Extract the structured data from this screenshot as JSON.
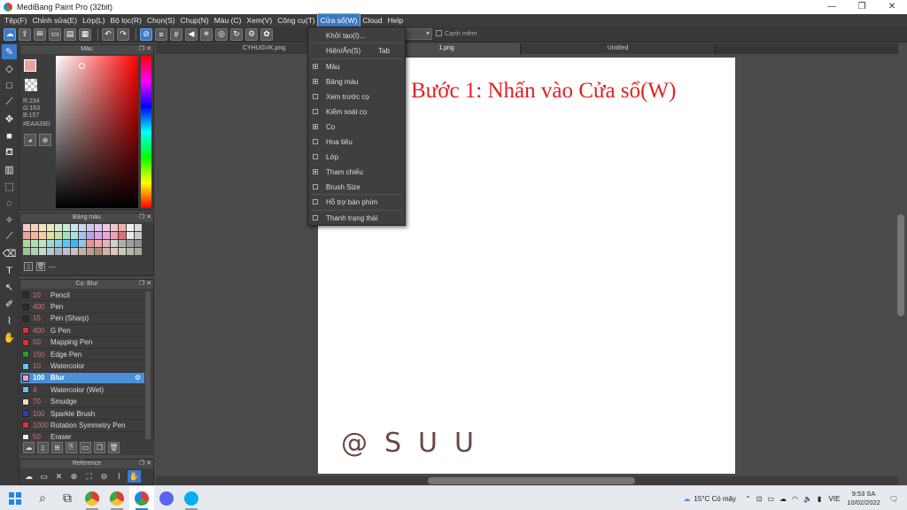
{
  "window": {
    "title": "MediBang Paint Pro (32bit)",
    "min": "—",
    "max": "❐",
    "close": "✕"
  },
  "menu": [
    {
      "label": "Tệp(F)",
      "active": false
    },
    {
      "label": "Chỉnh sửa(E)",
      "active": false
    },
    {
      "label": "Lớp(L)",
      "active": false
    },
    {
      "label": "Bộ lọc(R)",
      "active": false
    },
    {
      "label": "Chọn(S)",
      "active": false
    },
    {
      "label": "Chụp(N)",
      "active": false
    },
    {
      "label": "Màu (C)",
      "active": false
    },
    {
      "label": "Xem(V)",
      "active": false
    },
    {
      "label": "Công cụ(T)",
      "active": false
    },
    {
      "label": "Cửa sổ(W)",
      "active": true
    },
    {
      "label": "Cloud",
      "active": false
    },
    {
      "label": "Help",
      "active": false
    }
  ],
  "toolbar": {
    "antialias_label": "Cạnh mềm"
  },
  "color_panel": {
    "title": "Màu",
    "r": "R:234",
    "g": "G:163",
    "b": "B:157",
    "hex": "#EAA39D",
    "fg_color": "#EAA39D"
  },
  "palette_panel": {
    "title": "Bảng màu",
    "footer": "---",
    "swatches": [
      "#f4c7c3",
      "#f4d2c3",
      "#f4e0c3",
      "#e8e8c8",
      "#d9e8c8",
      "#c8e8d0",
      "#c8e8e8",
      "#c8d8ec",
      "#d0c8ec",
      "#e0c8ec",
      "#ecc8e0",
      "#f4c3d0",
      "#f0b0b0",
      "#f0f0f0",
      "#d8d8d8",
      "#f0a0a0",
      "#f4b4a0",
      "#f4d0a0",
      "#e0e0a8",
      "#c8e0a8",
      "#a8e0b8",
      "#a8e0e0",
      "#a8c4e8",
      "#b8a8e8",
      "#d4a8e8",
      "#e8a8d4",
      "#f0a0b8",
      "#e07070",
      "#e8e8e8",
      "#c8c8c8",
      "#a8d8a0",
      "#b0e0b0",
      "#c0e8c0",
      "#a0d8d0",
      "#80d0e8",
      "#60c8f0",
      "#40b8f0",
      "#90c8e8",
      "#f09090",
      "#f0a8a8",
      "#e8b0c0",
      "#d0d0d0",
      "#b0b0b0",
      "#a0a0a0",
      "#909090",
      "#a0c0a0",
      "#b8d0b8",
      "#c8d8c8",
      "#b8c8d8",
      "#a8b8c8",
      "#c0c0d0",
      "#d0c0c0",
      "#c8b0a0",
      "#b8a090",
      "#a89080",
      "#d0b8a8",
      "#e0c8b8",
      "#c8c8b8",
      "#b8b8a8",
      "#a8a898"
    ]
  },
  "brush_panel": {
    "title": "Cọ: Blur",
    "brushes": [
      {
        "color": "#2b2b2b",
        "size": "10",
        "name": "Pencil"
      },
      {
        "color": "#2b2b2b",
        "size": "400",
        "name": "Pen"
      },
      {
        "color": "#2b2b2b",
        "size": "15",
        "name": "Pen (Sharp)"
      },
      {
        "color": "#e53030",
        "size": "400",
        "name": "G Pen"
      },
      {
        "color": "#e53030",
        "size": "50",
        "name": "Mapping Pen"
      },
      {
        "color": "#20a030",
        "size": "150",
        "name": "Edge Pen"
      },
      {
        "color": "#60c8e8",
        "size": "10",
        "name": "Watercolor"
      },
      {
        "color": "#f4a0c0",
        "size": "100",
        "name": "Blur",
        "selected": true
      },
      {
        "color": "#60c8e8",
        "size": "4",
        "name": "Watercolor (Wet)"
      },
      {
        "color": "#f4d8c0",
        "size": "70",
        "name": "Smudge"
      },
      {
        "color": "#3040c0",
        "size": "100",
        "name": "Sparkle Brush"
      },
      {
        "color": "#e53030",
        "size": "1000",
        "name": "Rotation Symmetry Pen"
      },
      {
        "color": "#f0f0f0",
        "size": "50",
        "name": "Eraser"
      }
    ]
  },
  "reference_panel": {
    "title": "Reference"
  },
  "tabs": [
    {
      "label": "CYHUGVK.png",
      "active": false
    },
    {
      "label": "1.png",
      "active": true
    },
    {
      "label": "Untitled",
      "active": false
    }
  ],
  "canvas": {
    "instruction": "Bước 1: Nhấn vào Cửa sổ(W)",
    "watermark": "@SUU"
  },
  "window_menu": {
    "items": [
      {
        "label": "Khởi tạo(I)...",
        "check": null,
        "shortcut": ""
      },
      {
        "label": "Hiện/Ẩn(S)",
        "check": null,
        "shortcut": "Tab"
      },
      {
        "label": "Màu",
        "check": true,
        "shortcut": ""
      },
      {
        "label": "Bảng màu",
        "check": true,
        "shortcut": ""
      },
      {
        "label": "Xem trước cọ",
        "check": false,
        "shortcut": ""
      },
      {
        "label": "Kiểm soát cọ",
        "check": false,
        "shortcut": ""
      },
      {
        "label": "Cọ",
        "check": true,
        "shortcut": ""
      },
      {
        "label": "Hoa tiêu",
        "check": false,
        "shortcut": ""
      },
      {
        "label": "Lớp",
        "check": false,
        "shortcut": ""
      },
      {
        "label": "Tham chiếu",
        "check": true,
        "shortcut": ""
      },
      {
        "label": "Brush Size",
        "check": false,
        "shortcut": ""
      },
      {
        "label": "Hỗ trợ bàn phím",
        "check": false,
        "shortcut": ""
      },
      {
        "label": "Thanh trạng thái",
        "check": false,
        "shortcut": ""
      }
    ]
  },
  "taskbar": {
    "weather": "15°C  Có mây",
    "lang": "VIE",
    "time": "9:53 SA",
    "date": "10/02/2022"
  }
}
